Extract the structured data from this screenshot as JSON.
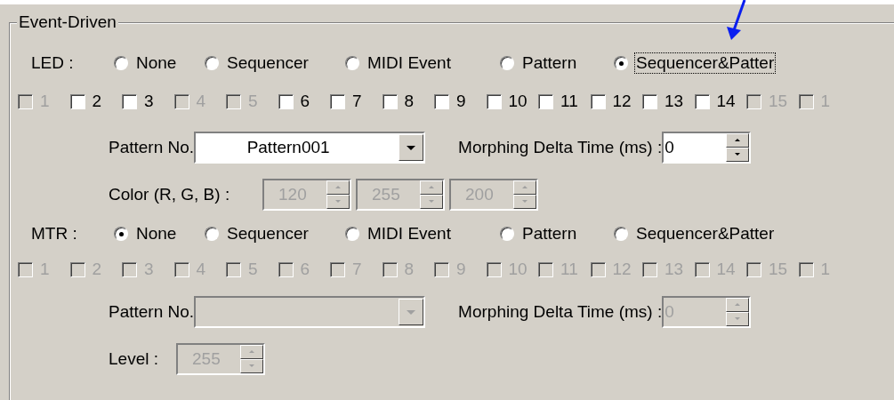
{
  "group": {
    "title": "Event-Driven",
    "sections": [
      {
        "label": "LED :",
        "options": [
          {
            "label": "None",
            "selected": false,
            "focused": false
          },
          {
            "label": "Sequencer",
            "selected": false,
            "focused": false
          },
          {
            "label": "MIDI Event",
            "selected": false,
            "focused": false
          },
          {
            "label": "Pattern",
            "selected": false,
            "focused": false
          },
          {
            "label": "Sequencer&Patter",
            "selected": true,
            "focused": true
          }
        ],
        "channels": [
          {
            "label": "1",
            "checked": false,
            "disabled": true
          },
          {
            "label": "2",
            "checked": false,
            "disabled": false
          },
          {
            "label": "3",
            "checked": false,
            "disabled": false
          },
          {
            "label": "4",
            "checked": false,
            "disabled": true
          },
          {
            "label": "5",
            "checked": false,
            "disabled": true
          },
          {
            "label": "6",
            "checked": false,
            "disabled": false
          },
          {
            "label": "7",
            "checked": false,
            "disabled": false
          },
          {
            "label": "8",
            "checked": false,
            "disabled": false
          },
          {
            "label": "9",
            "checked": false,
            "disabled": false
          },
          {
            "label": "10",
            "checked": false,
            "disabled": false
          },
          {
            "label": "11",
            "checked": false,
            "disabled": false
          },
          {
            "label": "12",
            "checked": false,
            "disabled": false
          },
          {
            "label": "13",
            "checked": false,
            "disabled": false
          },
          {
            "label": "14",
            "checked": false,
            "disabled": false
          },
          {
            "label": "15",
            "checked": false,
            "disabled": true
          },
          {
            "label": "1",
            "checked": false,
            "disabled": true
          }
        ],
        "pattern": {
          "label": "Pattern No.",
          "value": "Pattern001",
          "disabled": false
        },
        "morphing": {
          "label": "Morphing Delta Time (ms) :",
          "value": "0",
          "disabled": false
        },
        "extra": {
          "kind": "color",
          "label": "Color (R, G, B) :",
          "fields": [
            {
              "value": "120",
              "disabled": true
            },
            {
              "value": "255",
              "disabled": true
            },
            {
              "value": "200",
              "disabled": true
            }
          ]
        }
      },
      {
        "label": "MTR :",
        "options": [
          {
            "label": "None",
            "selected": true,
            "focused": false
          },
          {
            "label": "Sequencer",
            "selected": false,
            "focused": false
          },
          {
            "label": "MIDI Event",
            "selected": false,
            "focused": false
          },
          {
            "label": "Pattern",
            "selected": false,
            "focused": false
          },
          {
            "label": "Sequencer&Patter",
            "selected": false,
            "focused": false
          }
        ],
        "channels": [
          {
            "label": "1",
            "checked": false,
            "disabled": true
          },
          {
            "label": "2",
            "checked": false,
            "disabled": true
          },
          {
            "label": "3",
            "checked": false,
            "disabled": true
          },
          {
            "label": "4",
            "checked": false,
            "disabled": true
          },
          {
            "label": "5",
            "checked": false,
            "disabled": true
          },
          {
            "label": "6",
            "checked": false,
            "disabled": true
          },
          {
            "label": "7",
            "checked": false,
            "disabled": true
          },
          {
            "label": "8",
            "checked": false,
            "disabled": true
          },
          {
            "label": "9",
            "checked": false,
            "disabled": true
          },
          {
            "label": "10",
            "checked": false,
            "disabled": true
          },
          {
            "label": "11",
            "checked": false,
            "disabled": true
          },
          {
            "label": "12",
            "checked": false,
            "disabled": true
          },
          {
            "label": "13",
            "checked": false,
            "disabled": true
          },
          {
            "label": "14",
            "checked": false,
            "disabled": true
          },
          {
            "label": "15",
            "checked": false,
            "disabled": true
          },
          {
            "label": "1",
            "checked": false,
            "disabled": true
          }
        ],
        "pattern": {
          "label": "Pattern No.",
          "disabled": true
        },
        "morphing": {
          "label": "Morphing Delta Time (ms) :",
          "value": "0",
          "disabled": true
        },
        "extra": {
          "kind": "level",
          "label": "Level :",
          "fields": [
            {
              "value": "255",
              "disabled": true
            }
          ]
        }
      }
    ]
  }
}
